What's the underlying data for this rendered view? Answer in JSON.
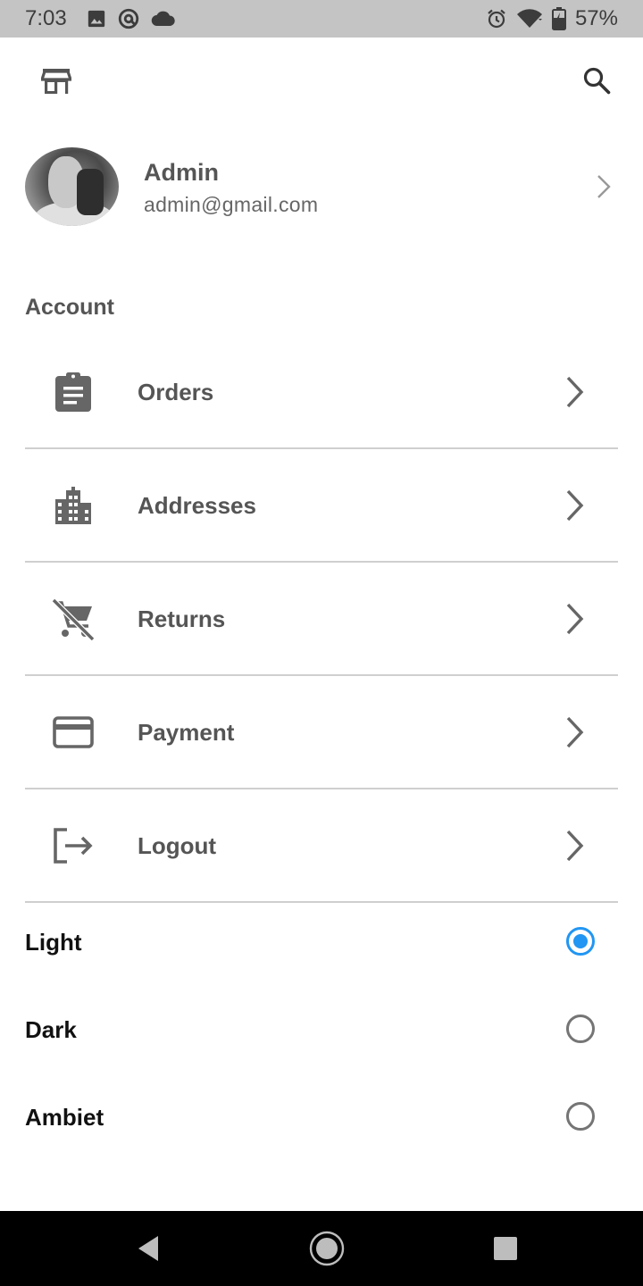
{
  "status_bar": {
    "time": "7:03",
    "battery": "57%",
    "icons_left": [
      "image-icon",
      "at-sign-icon",
      "cloud-icon"
    ],
    "icons_right": [
      "alarm-icon",
      "wifi-icon",
      "battery-charging-icon"
    ]
  },
  "top_bar": {
    "left_icon": "store-icon",
    "right_icon": "search-icon"
  },
  "profile": {
    "name": "Admin",
    "email": "admin@gmail.com"
  },
  "account": {
    "title": "Account",
    "items": [
      {
        "label": "Orders",
        "icon": "clipboard-icon"
      },
      {
        "label": "Addresses",
        "icon": "city-icon"
      },
      {
        "label": "Returns",
        "icon": "remove-shopping-cart-icon"
      },
      {
        "label": "Payment",
        "icon": "credit-card-icon"
      },
      {
        "label": "Logout",
        "icon": "logout-icon"
      }
    ]
  },
  "theme": {
    "selected": "Light",
    "options": [
      {
        "label": "Light",
        "checked": true
      },
      {
        "label": "Dark",
        "checked": false
      },
      {
        "label": "Ambiet",
        "checked": false
      }
    ]
  },
  "colors": {
    "accent": "#2196f3",
    "status_bar": "#c4c4c4",
    "divider": "#cfcfcf",
    "text": "#555555"
  }
}
